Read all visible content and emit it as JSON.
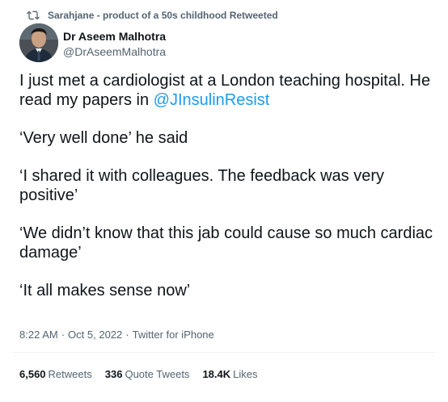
{
  "retweet": {
    "icon": "retweet-icon",
    "text": "Sarahjane - product of a 50s childhood Retweeted"
  },
  "author": {
    "avatar_icon": "avatar-photo",
    "name": "Dr Aseem Malhotra",
    "handle": "@DrAseemMalhotra"
  },
  "tweet": {
    "p1_before": "I just met a cardiologist at a London teaching hospital. He read my papers in ",
    "p1_mention": "@JInsulinResist",
    "p2": "‘Very well done’ he said",
    "p3": "‘I shared it with colleagues. The feedback was very positive’",
    "p4": "‘We didn’t know that this jab could cause so much cardiac damage’",
    "p5": "‘It all makes sense now’"
  },
  "meta": {
    "time": "8:22 AM",
    "date": "Oct 5, 2022",
    "source": "Twitter for iPhone",
    "separator": "·"
  },
  "stats": {
    "retweets_count": "6,560",
    "retweets_label": "Retweets",
    "quotes_count": "336",
    "quotes_label": "Quote Tweets",
    "likes_count": "18.4K",
    "likes_label": "Likes"
  },
  "colors": {
    "mention": "#1d9bf0",
    "secondary_text": "#536471",
    "primary_text": "#0f1419"
  }
}
